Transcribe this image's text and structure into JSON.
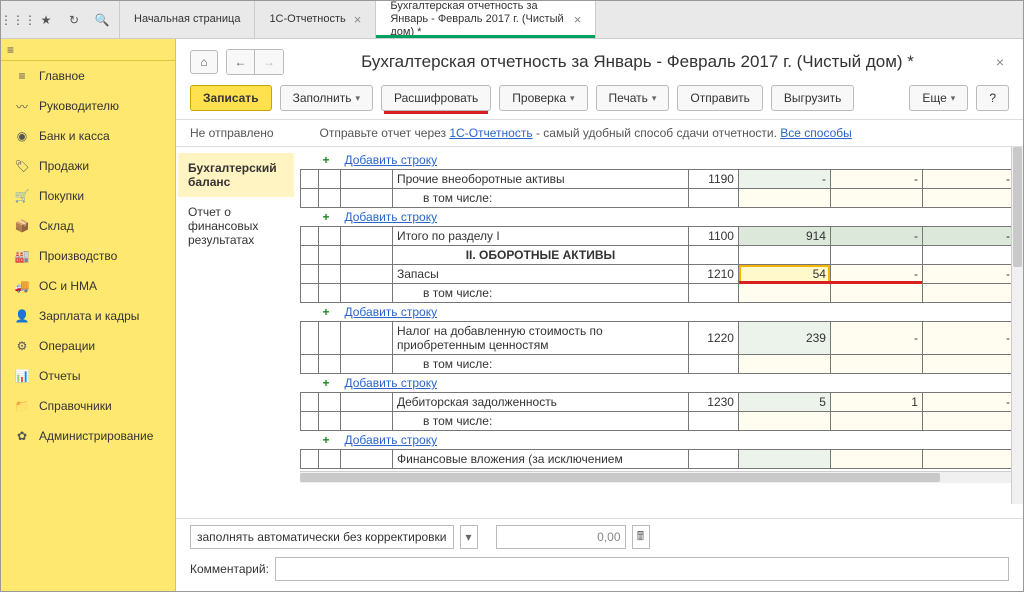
{
  "topbar": {
    "tabs": [
      {
        "label": "Начальная страница",
        "closable": false
      },
      {
        "label": "1С-Отчетность",
        "closable": true
      },
      {
        "label": "Бухгалтерская отчетность за Январь - Февраль 2017 г. (Чистый дом) *",
        "closable": true,
        "active": true
      }
    ]
  },
  "sidebar": {
    "items": [
      {
        "icon": "home",
        "label": "Главное"
      },
      {
        "icon": "pulse",
        "label": "Руководителю"
      },
      {
        "icon": "bank",
        "label": "Банк и касса"
      },
      {
        "icon": "sales",
        "label": "Продажи"
      },
      {
        "icon": "cart",
        "label": "Покупки"
      },
      {
        "icon": "box",
        "label": "Склад"
      },
      {
        "icon": "factory",
        "label": "Производство"
      },
      {
        "icon": "truck",
        "label": "ОС и НМА"
      },
      {
        "icon": "person",
        "label": "Зарплата и кадры"
      },
      {
        "icon": "ops",
        "label": "Операции"
      },
      {
        "icon": "chart",
        "label": "Отчеты"
      },
      {
        "icon": "folder",
        "label": "Справочники"
      },
      {
        "icon": "gear",
        "label": "Администрирование"
      }
    ]
  },
  "page": {
    "title": "Бухгалтерская отчетность за Январь - Февраль 2017 г. (Чистый дом) *",
    "toolbar": {
      "save": "Записать",
      "fill": "Заполнить",
      "decode": "Расшифровать",
      "check": "Проверка",
      "print": "Печать",
      "send": "Отправить",
      "export": "Выгрузить",
      "more": "Еще",
      "help": "?"
    },
    "status": {
      "state": "Не отправлено",
      "prefix": "Отправьте отчет через ",
      "link1": "1С-Отчетность",
      "middle": " - самый удобный способ сдачи отчетности. ",
      "link2": "Все способы"
    },
    "sections": [
      {
        "label": "Бухгалтерский баланс",
        "active": true
      },
      {
        "label": "Отчет о финансовых результатах"
      }
    ],
    "addrow": "Добавить строку",
    "rows": {
      "other_nonc": {
        "name": "Прочие внеоборотные активы",
        "code": "1190",
        "v1": "-",
        "v2": "-",
        "v3": "-"
      },
      "incl": {
        "name": "в том числе:"
      },
      "section1_total": {
        "name": "Итого по разделу І",
        "code": "1100",
        "v1": "914",
        "v2": "-",
        "v3": "-"
      },
      "section2_hdr": {
        "name": "II. ОБОРОТНЫЕ АКТИВЫ"
      },
      "stocks": {
        "name": "Запасы",
        "code": "1210",
        "v1": "54",
        "v2": "-",
        "v3": "-"
      },
      "vat": {
        "name": "Налог на добавленную стоимость по приобретенным ценностям",
        "code": "1220",
        "v1": "239",
        "v2": "-",
        "v3": "-"
      },
      "receivables": {
        "name": "Дебиторская задолженность",
        "code": "1230",
        "v1": "5",
        "v2": "1",
        "v3": "-"
      },
      "fin": {
        "name": "Финансовые вложения (за исключением"
      }
    },
    "footer": {
      "mode": "заполнять автоматически без корректировки",
      "num": "0,00",
      "comment_label": "Комментарий:"
    }
  }
}
